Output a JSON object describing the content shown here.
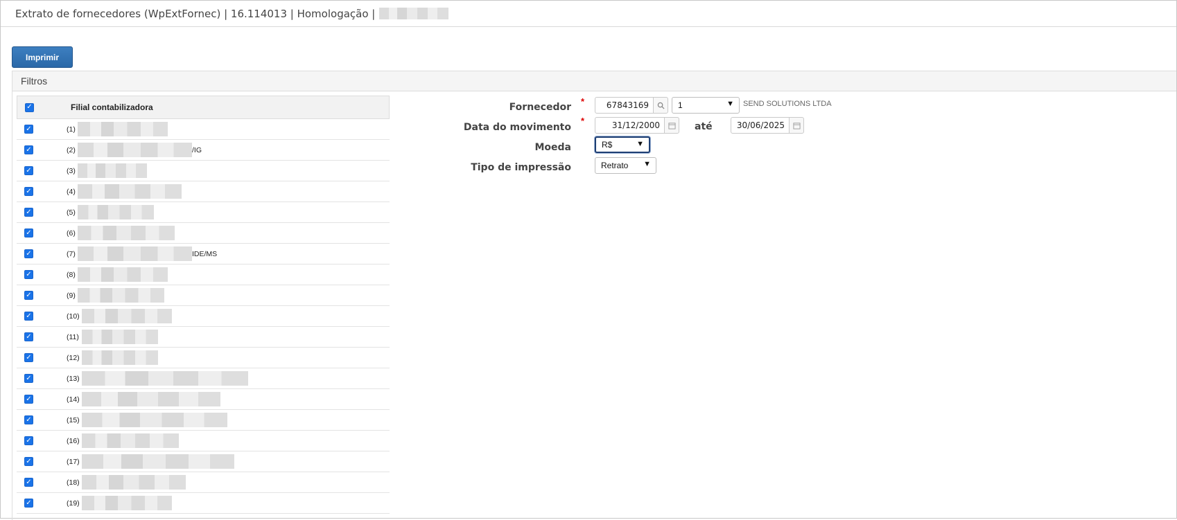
{
  "window": {
    "title": "Extrato de fornecedores (WpExtFornec) | 16.114013 | Homologação |"
  },
  "toolbar": {
    "print_label": "Imprimir"
  },
  "filters": {
    "section_label": "Filtros",
    "table": {
      "header_label": "Filial contabilizadora",
      "header_checked": true,
      "rows": [
        {
          "index": "(1)",
          "suffix": "",
          "checked": true
        },
        {
          "index": "(2)",
          "suffix": "/IG",
          "checked": true
        },
        {
          "index": "(3)",
          "suffix": "",
          "checked": true
        },
        {
          "index": "(4)",
          "suffix": "",
          "checked": true
        },
        {
          "index": "(5)",
          "suffix": "",
          "checked": true
        },
        {
          "index": "(6)",
          "suffix": "",
          "checked": true
        },
        {
          "index": "(7)",
          "suffix": "IDE/MS",
          "checked": true
        },
        {
          "index": "(8)",
          "suffix": "",
          "checked": true
        },
        {
          "index": "(9)",
          "suffix": "",
          "checked": true
        },
        {
          "index": "(10)",
          "suffix": "",
          "checked": true
        },
        {
          "index": "(11)",
          "suffix": "",
          "checked": true
        },
        {
          "index": "(12)",
          "suffix": "",
          "checked": true
        },
        {
          "index": "(13)",
          "suffix": "",
          "checked": true
        },
        {
          "index": "(14)",
          "suffix": "",
          "checked": true
        },
        {
          "index": "(15)",
          "suffix": "",
          "checked": true
        },
        {
          "index": "(16)",
          "suffix": "",
          "checked": true
        },
        {
          "index": "(17)",
          "suffix": "",
          "checked": true
        },
        {
          "index": "(18)",
          "suffix": "",
          "checked": true
        },
        {
          "index": "(19)",
          "suffix": "",
          "checked": true
        }
      ]
    },
    "form": {
      "fornecedor": {
        "label": "Fornecedor",
        "required_mark": "*",
        "code": "67843169",
        "branch_selected": "1",
        "name": "SEND SOLUTIONS LTDA",
        "search_icon": "search-icon"
      },
      "data_movimento": {
        "label": "Data do movimento",
        "required_mark": "*",
        "from": "31/12/2000",
        "to_label": "até",
        "to": "30/06/2025",
        "calendar_icon": "calendar-icon"
      },
      "moeda": {
        "label": "Moeda",
        "selected": "R$"
      },
      "tipo_impressao": {
        "label": "Tipo de impressão",
        "selected": "Retrato"
      }
    }
  },
  "colors": {
    "button_primary": "#2f70b2",
    "checkbox": "#1a73e8",
    "required": "#dd0000"
  }
}
